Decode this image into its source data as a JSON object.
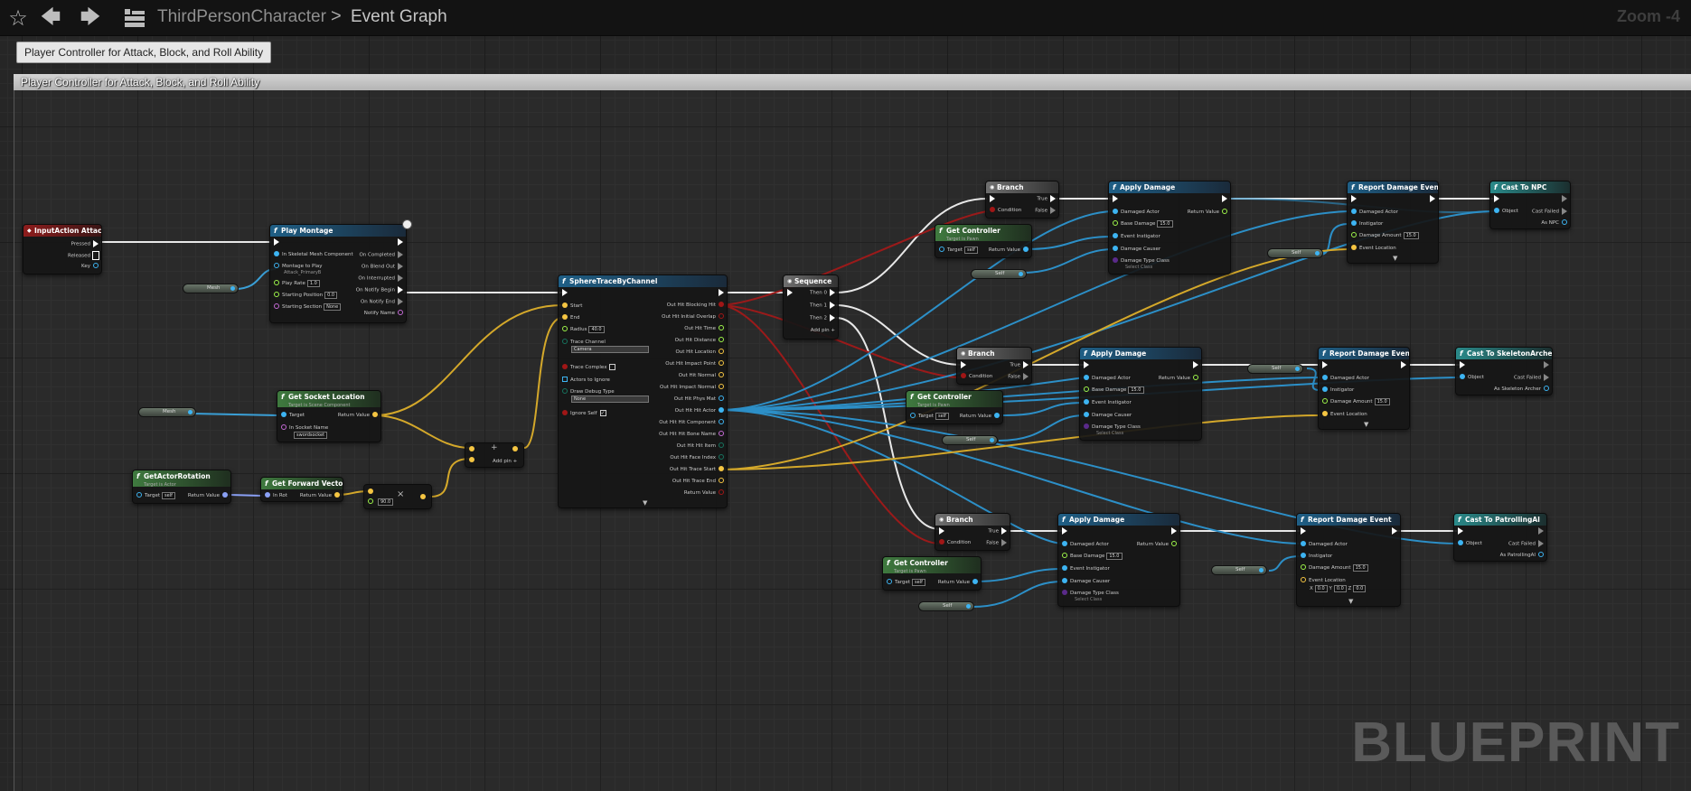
{
  "header": {
    "breadcrumb_root": "ThirdPersonCharacter",
    "breadcrumb_sep": ">",
    "breadcrumb_leaf": "Event Graph",
    "zoom": "Zoom -4",
    "icons": {
      "favorite": "star-icon",
      "back": "arrow-left-icon",
      "forward": "arrow-right-icon",
      "blueprint": "blueprint-grid-icon"
    }
  },
  "tooltip": "Player Controller for Attack, Block, and Roll Ability",
  "comment": {
    "title": "Player Controller for Attack, Block, and Roll Ability"
  },
  "watermark": "BLUEPRINT",
  "nodes": {
    "input_attack": {
      "title": "InputAction Attack",
      "pressed": "Pressed",
      "released": "Released",
      "key": "Key"
    },
    "play_montage": {
      "title": "Play Montage",
      "in_mesh": "In Skeletal Mesh Component",
      "montage": "Montage to Play",
      "montage_val": "Attack_PrimaryB",
      "play_rate": "Play Rate",
      "play_rate_val": "1.0",
      "start_pos": "Starting Position",
      "start_pos_val": "0.0",
      "start_sec": "Starting Section",
      "start_sec_val": "None",
      "on_completed": "On Completed",
      "on_blend_out": "On Blend Out",
      "on_interrupted": "On Interrupted",
      "on_notify_begin": "On Notify Begin",
      "on_notify_end": "On Notify End",
      "notify_name": "Notify Name"
    },
    "mesh_pill_1": "Mesh",
    "mesh_pill_2": "Mesh",
    "get_socket_location": {
      "title": "Get Socket Location",
      "sub": "Target is Scene Component",
      "target": "Target",
      "in_socket": "In Socket Name",
      "socket_val": "swordsocket",
      "ret": "Return Value"
    },
    "get_actor_rotation": {
      "title": "GetActorRotation",
      "sub": "Target is Actor",
      "target": "Target",
      "self": "self",
      "ret": "Return Value"
    },
    "get_forward_vector": {
      "title": "Get Forward Vector",
      "in_rot": "In Rot",
      "ret": "Return Value"
    },
    "multiply": {
      "symbol": "×",
      "val": "90.0"
    },
    "add": {
      "symbol": "+",
      "add_pin": "Add pin"
    },
    "sphere_trace": {
      "title": "SphereTraceByChannel",
      "start": "Start",
      "end": "End",
      "radius": "Radius",
      "radius_val": "40.0",
      "trace_channel": "Trace Channel",
      "trace_channel_val": "Camera",
      "trace_complex": "Trace Complex",
      "actors_ignore": "Actors to Ignore",
      "draw_debug": "Draw Debug Type",
      "draw_debug_val": "None",
      "ignore_self": "Ignore Self",
      "outputs": [
        "Out Hit Blocking Hit",
        "Out Hit Initial Overlap",
        "Out Hit Time",
        "Out Hit Distance",
        "Out Hit Location",
        "Out Hit Impact Point",
        "Out Hit Normal",
        "Out Hit Impact Normal",
        "Out Hit Phys Mat",
        "Out Hit Hit Actor",
        "Out Hit Hit Component",
        "Out Hit Hit Bone Name",
        "Out Hit Hit Item",
        "Out Hit Face Index",
        "Out Hit Trace Start",
        "Out Hit Trace End",
        "Return Value"
      ]
    },
    "sequence": {
      "title": "Sequence",
      "then0": "Then 0",
      "then1": "Then 1",
      "then2": "Then 2",
      "add_pin": "Add pin"
    },
    "branch1": {
      "title": "Branch",
      "cond": "Condition",
      "t": "True",
      "f": "False"
    },
    "branch2": {
      "title": "Branch",
      "cond": "Condition",
      "t": "True",
      "f": "False"
    },
    "branch3": {
      "title": "Branch",
      "cond": "Condition",
      "t": "True",
      "f": "False"
    },
    "get_controller1": {
      "title": "Get Controller",
      "sub": "Target is Pawn",
      "target": "Target",
      "self": "self",
      "ret": "Return Value"
    },
    "get_controller2": {
      "title": "Get Controller",
      "sub": "Target is Pawn",
      "target": "Target",
      "self": "self",
      "ret": "Return Value"
    },
    "get_controller3": {
      "title": "Get Controller",
      "sub": "Target is Pawn",
      "target": "Target",
      "self": "self",
      "ret": "Return Value"
    },
    "self_pills": [
      "Self",
      "Self",
      "Self",
      "Self",
      "Self",
      "Self"
    ],
    "apply_damage1": {
      "title": "Apply Damage",
      "damaged": "Damaged Actor",
      "base": "Base Damage",
      "base_val": "15.0",
      "instig": "Event Instigator",
      "causer": "Damage Causer",
      "cls": "Damage Type Class",
      "cls_val": "Select Class",
      "ret": "Return Value"
    },
    "apply_damage2": {
      "title": "Apply Damage",
      "damaged": "Damaged Actor",
      "base": "Base Damage",
      "base_val": "15.0",
      "instig": "Event Instigator",
      "causer": "Damage Causer",
      "cls": "Damage Type Class",
      "cls_val": "Select Class",
      "ret": "Return Value"
    },
    "apply_damage3": {
      "title": "Apply Damage",
      "damaged": "Damaged Actor",
      "base": "Base Damage",
      "base_val": "15.0",
      "instig": "Event Instigator",
      "causer": "Damage Causer",
      "cls": "Damage Type Class",
      "cls_val": "Select Class",
      "ret": "Return Value"
    },
    "report1": {
      "title": "Report Damage Event",
      "damaged": "Damaged Actor",
      "instig": "Instigator",
      "amount": "Damage Amount",
      "amount_val": "15.0",
      "loc": "Event Location"
    },
    "report2": {
      "title": "Report Damage Event",
      "damaged": "Damaged Actor",
      "instig": "Instigator",
      "amount": "Damage Amount",
      "amount_val": "15.0",
      "loc": "Event Location"
    },
    "report3": {
      "title": "Report Damage Event",
      "damaged": "Damaged Actor",
      "instig": "Instigator",
      "amount": "Damage Amount",
      "amount_val": "15.0",
      "loc": "Event Location",
      "loc_x": "0.0",
      "loc_y": "0.0",
      "loc_z": "0.0"
    },
    "cast_npc": {
      "title": "Cast To NPC",
      "object": "Object",
      "failed": "Cast Failed",
      "as": "As NPC"
    },
    "cast_archer": {
      "title": "Cast To SkeletonArcher",
      "object": "Object",
      "failed": "Cast Failed",
      "as": "As Skeleton Archer"
    },
    "cast_patrol": {
      "title": "Cast To PatrollingAI",
      "object": "Object",
      "failed": "Cast Failed",
      "as": "As PatrollingAI"
    }
  }
}
